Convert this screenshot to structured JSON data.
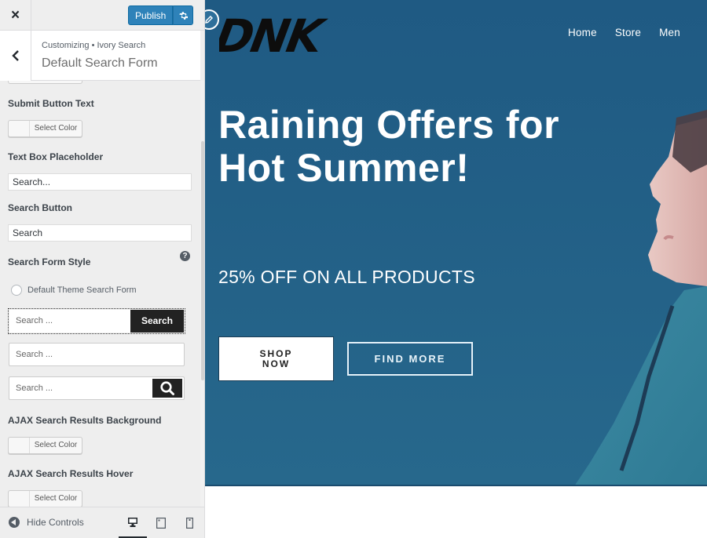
{
  "sidebar": {
    "close_label": "×",
    "publish_label": "Publish",
    "publish_color": "#2e82b9",
    "breadcrumb": "Customizing • Ivory Search",
    "title": "Default Search Form",
    "controls": {
      "submit_button_text": {
        "label": "Submit Button Text",
        "picker_label": "Select Color"
      },
      "text_box_placeholder": {
        "label": "Text Box Placeholder",
        "value": "Search..."
      },
      "search_button": {
        "label": "Search Button",
        "value": "Search"
      },
      "search_form_style": {
        "label": "Search Form Style",
        "help": "?",
        "options": [
          {
            "label": "Default Theme Search Form",
            "selected": false
          },
          {
            "placeholder": "Search ...",
            "button": "Search",
            "selected": true
          },
          {
            "placeholder": "Search ...",
            "selected": false
          },
          {
            "placeholder": "Search ...",
            "button_icon": "search-icon",
            "selected": false
          }
        ]
      },
      "ajax_bg": {
        "label": "AJAX Search Results Background",
        "picker_label": "Select Color"
      },
      "ajax_hover": {
        "label": "AJAX Search Results Hover",
        "picker_label": "Select Color"
      }
    },
    "footer": {
      "hide_controls_label": "Hide Controls",
      "devices": [
        "desktop",
        "tablet",
        "mobile"
      ],
      "active_device": "desktop"
    }
  },
  "preview": {
    "logo": "DNK",
    "nav": [
      "Home",
      "Store",
      "Men"
    ],
    "hero": {
      "title": "Raining Offers for Hot Summer!",
      "subtitle": "25% OFF ON ALL PRODUCTS",
      "primary_cta": "SHOP NOW",
      "secondary_cta": "FIND MORE",
      "background_color": "#225f86"
    }
  }
}
